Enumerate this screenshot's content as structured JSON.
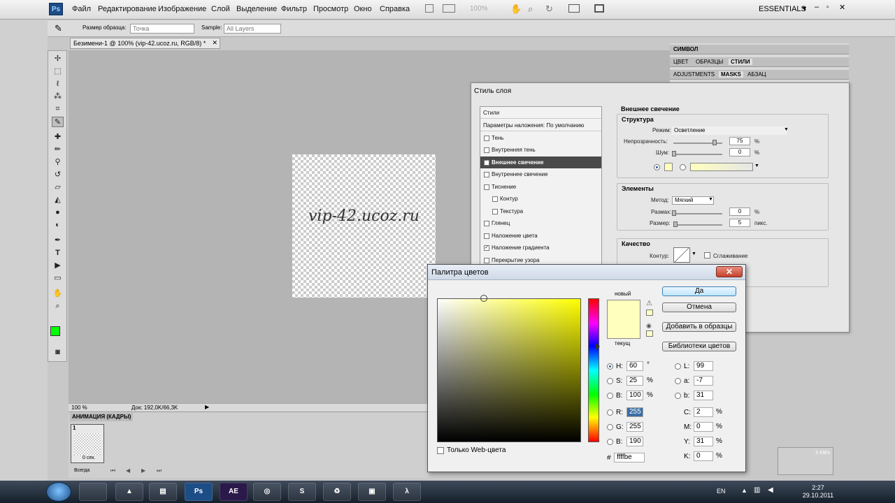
{
  "menubar": {
    "logo": "Ps",
    "items": [
      "Файл",
      "Редактирование",
      "Изображение",
      "Слой",
      "Выделение",
      "Фильтр",
      "Просмотр",
      "Окно",
      "Справка"
    ],
    "zoom": "100%",
    "workspace": "ESSENTIALS"
  },
  "options_bar": {
    "sample_size_label": "Размер образца:",
    "sample_size_value": "Точка",
    "sample_label": "Sample:",
    "sample_value": "All Layers"
  },
  "document": {
    "tab_title": "Безимени-1 @ 100% (vip-42.ucoz.ru, RGB/8) *",
    "canvas_text": "vip-42.ucoz.ru",
    "status_zoom": "100 %",
    "status_doc": "Док: 192,0K/66,3K"
  },
  "animation_panel": {
    "title": "АНИМАЦИЯ (КАДРЫ)",
    "frame_number": "1",
    "frame_delay": "0 сек.",
    "loop": "Всегда"
  },
  "right_panel": {
    "row1": [
      "СИМВОЛ"
    ],
    "row2": [
      "ЦВЕТ",
      "ОБРАЗЦЫ",
      "СТИЛИ"
    ],
    "row3": [
      "ADJUSTMENTS",
      "MASKS",
      "АБЗАЦ"
    ]
  },
  "layer_style": {
    "title": "Стиль слоя",
    "list": [
      {
        "label": "Стили",
        "checkbox": false,
        "checked": false,
        "selected": false,
        "sub": false
      },
      {
        "label": "Параметры наложения: По умолчанию",
        "checkbox": false,
        "checked": false,
        "selected": false,
        "sub": false
      },
      {
        "label": "Тень",
        "checkbox": true,
        "checked": false,
        "selected": false,
        "sub": false
      },
      {
        "label": "Внутренняя тень",
        "checkbox": true,
        "checked": false,
        "selected": false,
        "sub": false
      },
      {
        "label": "Внешнее свечение",
        "checkbox": true,
        "checked": true,
        "selected": true,
        "sub": false
      },
      {
        "label": "Внутреннее свечение",
        "checkbox": true,
        "checked": false,
        "selected": false,
        "sub": false
      },
      {
        "label": "Тиснение",
        "checkbox": true,
        "checked": false,
        "selected": false,
        "sub": false
      },
      {
        "label": "Контур",
        "checkbox": true,
        "checked": false,
        "selected": false,
        "sub": true
      },
      {
        "label": "Текстура",
        "checkbox": true,
        "checked": false,
        "selected": false,
        "sub": true
      },
      {
        "label": "Глянец",
        "checkbox": true,
        "checked": false,
        "selected": false,
        "sub": false
      },
      {
        "label": "Наложение цвета",
        "checkbox": true,
        "checked": false,
        "selected": false,
        "sub": false
      },
      {
        "label": "Наложение градиента",
        "checkbox": true,
        "checked": true,
        "selected": false,
        "sub": false
      },
      {
        "label": "Перекрытие узора",
        "checkbox": true,
        "checked": false,
        "selected": false,
        "sub": false
      }
    ],
    "section_title": "Внешнее свечение",
    "structure": {
      "heading": "Структура",
      "mode_label": "Режим:",
      "mode_value": "Осветление",
      "opacity_label": "Непрозрачность:",
      "opacity_value": "75",
      "noise_label": "Шум:",
      "noise_value": "0",
      "percent": "%"
    },
    "elements": {
      "heading": "Элементы",
      "method_label": "Метод:",
      "method_value": "Мягкий",
      "spread_label": "Размах:",
      "spread_value": "0",
      "size_label": "Размер:",
      "size_value": "5",
      "percent": "%",
      "px": "пикс."
    },
    "quality": {
      "heading": "Качество",
      "contour_label": "Контур:",
      "antialias_label": "Сглаживание"
    }
  },
  "color_picker": {
    "title": "Палитра цветов",
    "new_label": "новый",
    "current_label": "текущ",
    "buttons": {
      "ok": "Да",
      "cancel": "Отмена",
      "add_to_swatches": "Добавить в образцы",
      "libraries": "Библиотеки цветов"
    },
    "web_only_label": "Только Web-цвета",
    "hsb": [
      {
        "label": "H:",
        "value": "60",
        "unit": "°",
        "selected": true
      },
      {
        "label": "S:",
        "value": "25",
        "unit": "%",
        "selected": false
      },
      {
        "label": "B:",
        "value": "100",
        "unit": "%",
        "selected": false
      }
    ],
    "rgb": [
      {
        "label": "R:",
        "value": "255"
      },
      {
        "label": "G:",
        "value": "255"
      },
      {
        "label": "B:",
        "value": "190"
      }
    ],
    "lab": [
      {
        "label": "L:",
        "value": "99"
      },
      {
        "label": "a:",
        "value": "-7"
      },
      {
        "label": "b:",
        "value": "31"
      }
    ],
    "cmyk": [
      {
        "label": "C:",
        "value": "2",
        "unit": "%"
      },
      {
        "label": "M:",
        "value": "0",
        "unit": "%"
      },
      {
        "label": "Y:",
        "value": "31",
        "unit": "%"
      },
      {
        "label": "K:",
        "value": "0",
        "unit": "%"
      }
    ],
    "hex_label": "#",
    "hex": "ffffbe",
    "colors": {
      "selected": "#ffffbe"
    }
  },
  "net_widget": {
    "speed": "5 KB/s"
  },
  "taskbar": {
    "lang": "EN",
    "time": "2:27",
    "date": "29.10.2011",
    "apps": [
      "Ps",
      "AE"
    ]
  }
}
